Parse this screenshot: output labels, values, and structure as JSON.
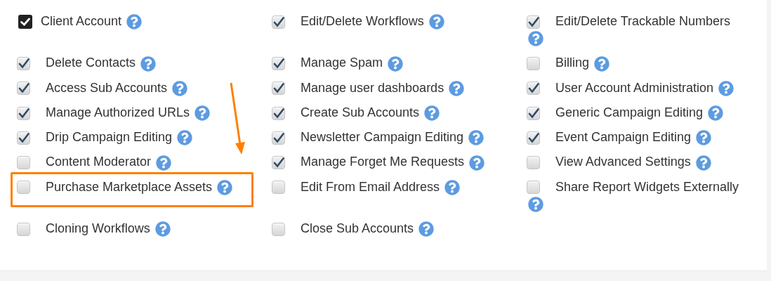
{
  "permissions": [
    {
      "label": "Client Account",
      "kind": "master",
      "checked": true,
      "highlighted": false
    },
    {
      "label": "Edit/Delete Workflows",
      "kind": "permission",
      "checked": true,
      "highlighted": false
    },
    {
      "label": "Edit/Delete Trackable Numbers",
      "kind": "permission",
      "checked": true,
      "highlighted": false
    },
    {
      "label": "Delete Contacts",
      "kind": "permission",
      "checked": true,
      "highlighted": false
    },
    {
      "label": "Manage Spam",
      "kind": "permission",
      "checked": true,
      "highlighted": false
    },
    {
      "label": "Billing",
      "kind": "permission",
      "checked": false,
      "highlighted": false
    },
    {
      "label": "Access Sub Accounts",
      "kind": "permission",
      "checked": true,
      "highlighted": false
    },
    {
      "label": "Manage user dashboards",
      "kind": "permission",
      "checked": true,
      "highlighted": false
    },
    {
      "label": "User Account Administration",
      "kind": "permission",
      "checked": true,
      "highlighted": false
    },
    {
      "label": "Manage Authorized URLs",
      "kind": "permission",
      "checked": true,
      "highlighted": false
    },
    {
      "label": "Create Sub Accounts",
      "kind": "permission",
      "checked": true,
      "highlighted": false
    },
    {
      "label": "Generic Campaign Editing",
      "kind": "permission",
      "checked": true,
      "highlighted": false
    },
    {
      "label": "Drip Campaign Editing",
      "kind": "permission",
      "checked": true,
      "highlighted": false
    },
    {
      "label": "Newsletter Campaign Editing",
      "kind": "permission",
      "checked": true,
      "highlighted": false
    },
    {
      "label": "Event Campaign Editing",
      "kind": "permission",
      "checked": true,
      "highlighted": false
    },
    {
      "label": "Content Moderator",
      "kind": "permission",
      "checked": false,
      "highlighted": false
    },
    {
      "label": "Manage Forget Me Requests",
      "kind": "permission",
      "checked": true,
      "highlighted": false
    },
    {
      "label": "View Advanced Settings",
      "kind": "permission",
      "checked": false,
      "highlighted": false
    },
    {
      "label": "Purchase Marketplace Assets",
      "kind": "permission",
      "checked": false,
      "highlighted": true
    },
    {
      "label": "Edit From Email Address",
      "kind": "permission",
      "checked": false,
      "highlighted": false
    },
    {
      "label": "Share Report Widgets Externally",
      "kind": "permission",
      "checked": false,
      "highlighted": false
    },
    {
      "label": "Cloning Workflows",
      "kind": "permission",
      "checked": false,
      "highlighted": false
    },
    {
      "label": "Close Sub Accounts",
      "kind": "permission",
      "checked": false,
      "highlighted": false
    }
  ]
}
